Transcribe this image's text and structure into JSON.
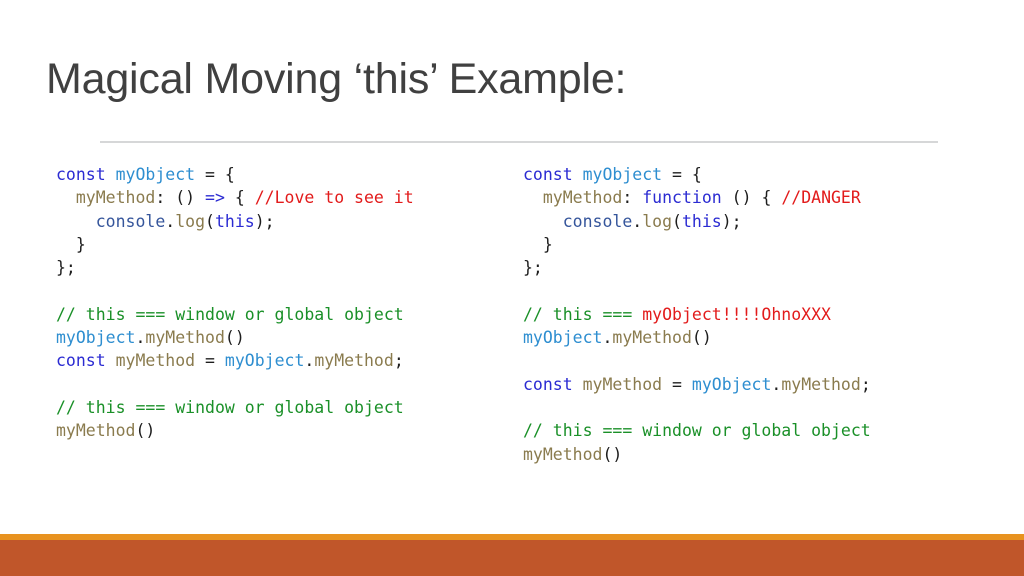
{
  "slide": {
    "title": "Magical Moving ‘this’ Example:",
    "title_color": "#404040",
    "background_color": "#ffffff"
  },
  "divider": {
    "name": "title-rule",
    "color": "#d6d7d8"
  },
  "accent_bars": {
    "thin_color": "#e8921f",
    "thick_color": "#c0562a"
  },
  "syntax_colors": {
    "keyword": "#2b2bd2",
    "object": "#2e8ed0",
    "member": "#8a7b4e",
    "console": "#35559b",
    "this": "#2b2bd2",
    "plain": "#1d1d1d",
    "comment_red": "#e21b1b",
    "comment_green": "#1a9028"
  },
  "code_left": {
    "name": "arrow-function-example",
    "lines": [
      [
        {
          "t": "const",
          "c": "keyword"
        },
        {
          "t": " ",
          "c": "plain"
        },
        {
          "t": "myObject",
          "c": "object"
        },
        {
          "t": " = {",
          "c": "plain"
        }
      ],
      [
        {
          "t": "  ",
          "c": "plain"
        },
        {
          "t": "myMethod",
          "c": "member"
        },
        {
          "t": ": () ",
          "c": "plain"
        },
        {
          "t": "=>",
          "c": "arrow"
        },
        {
          "t": " { ",
          "c": "plain"
        },
        {
          "t": "//Love to see it",
          "c": "comment_red"
        }
      ],
      [
        {
          "t": "    ",
          "c": "plain"
        },
        {
          "t": "console",
          "c": "console"
        },
        {
          "t": ".",
          "c": "plain"
        },
        {
          "t": "log",
          "c": "member"
        },
        {
          "t": "(",
          "c": "plain"
        },
        {
          "t": "this",
          "c": "this"
        },
        {
          "t": ");",
          "c": "plain"
        }
      ],
      [
        {
          "t": "  }",
          "c": "plain"
        }
      ],
      [
        {
          "t": "};",
          "c": "plain"
        }
      ],
      [],
      [
        {
          "t": "// this === window or global object",
          "c": "comment_green"
        }
      ],
      [
        {
          "t": "myObject",
          "c": "object"
        },
        {
          "t": ".",
          "c": "plain"
        },
        {
          "t": "myMethod",
          "c": "member"
        },
        {
          "t": "()",
          "c": "plain"
        }
      ],
      [
        {
          "t": "const",
          "c": "keyword"
        },
        {
          "t": " ",
          "c": "plain"
        },
        {
          "t": "myMethod",
          "c": "member"
        },
        {
          "t": " = ",
          "c": "plain"
        },
        {
          "t": "myObject",
          "c": "object"
        },
        {
          "t": ".",
          "c": "plain"
        },
        {
          "t": "myMethod",
          "c": "member"
        },
        {
          "t": ";",
          "c": "plain"
        }
      ],
      [],
      [
        {
          "t": "// this === window or global object",
          "c": "comment_green"
        }
      ],
      [
        {
          "t": "myMethod",
          "c": "member"
        },
        {
          "t": "()",
          "c": "plain"
        }
      ]
    ]
  },
  "code_right": {
    "name": "function-expression-example",
    "lines": [
      [
        {
          "t": "const",
          "c": "keyword"
        },
        {
          "t": " ",
          "c": "plain"
        },
        {
          "t": "myObject",
          "c": "object"
        },
        {
          "t": " = {",
          "c": "plain"
        }
      ],
      [
        {
          "t": "  ",
          "c": "plain"
        },
        {
          "t": "myMethod",
          "c": "member"
        },
        {
          "t": ": ",
          "c": "plain"
        },
        {
          "t": "function",
          "c": "keyword"
        },
        {
          "t": " () { ",
          "c": "plain"
        },
        {
          "t": "//DANGER",
          "c": "comment_red"
        }
      ],
      [
        {
          "t": "    ",
          "c": "plain"
        },
        {
          "t": "console",
          "c": "console"
        },
        {
          "t": ".",
          "c": "plain"
        },
        {
          "t": "log",
          "c": "member"
        },
        {
          "t": "(",
          "c": "plain"
        },
        {
          "t": "this",
          "c": "this"
        },
        {
          "t": ");",
          "c": "plain"
        }
      ],
      [
        {
          "t": "  }",
          "c": "plain"
        }
      ],
      [
        {
          "t": "};",
          "c": "plain"
        }
      ],
      [],
      [
        {
          "t": "// this === ",
          "c": "comment_green"
        },
        {
          "t": "myObject!!!!OhnoXXX",
          "c": "comment_red"
        }
      ],
      [
        {
          "t": "myObject",
          "c": "object"
        },
        {
          "t": ".",
          "c": "plain"
        },
        {
          "t": "myMethod",
          "c": "member"
        },
        {
          "t": "()",
          "c": "plain"
        }
      ],
      [],
      [
        {
          "t": "const",
          "c": "keyword"
        },
        {
          "t": " ",
          "c": "plain"
        },
        {
          "t": "myMethod",
          "c": "member"
        },
        {
          "t": " = ",
          "c": "plain"
        },
        {
          "t": "myObject",
          "c": "object"
        },
        {
          "t": ".",
          "c": "plain"
        },
        {
          "t": "myMethod",
          "c": "member"
        },
        {
          "t": ";",
          "c": "plain"
        }
      ],
      [],
      [
        {
          "t": "// this === window or global object",
          "c": "comment_green"
        }
      ],
      [
        {
          "t": "myMethod",
          "c": "member"
        },
        {
          "t": "()",
          "c": "plain"
        }
      ]
    ]
  }
}
